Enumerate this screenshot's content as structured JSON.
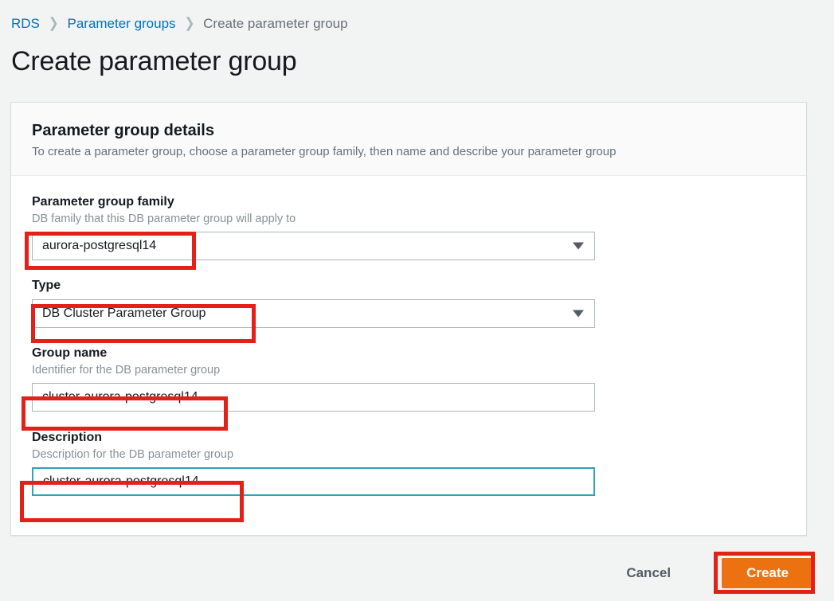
{
  "breadcrumb": {
    "items": [
      {
        "label": "RDS",
        "type": "link"
      },
      {
        "label": "Parameter groups",
        "type": "link"
      },
      {
        "label": "Create parameter group",
        "type": "current"
      }
    ],
    "separator": "❯"
  },
  "page": {
    "title": "Create parameter group"
  },
  "panel": {
    "title": "Parameter group details",
    "subtitle": "To create a parameter group, choose a parameter group family, then name and describe your parameter group"
  },
  "form": {
    "family": {
      "label": "Parameter group family",
      "hint": "DB family that this DB parameter group will apply to",
      "value": "aurora-postgresql14",
      "control": "select"
    },
    "type": {
      "label": "Type",
      "value": "DB Cluster Parameter Group",
      "control": "select"
    },
    "group_name": {
      "label": "Group name",
      "hint": "Identifier for the DB parameter group",
      "value": "cluster-aurora-postgresql14",
      "control": "text"
    },
    "description": {
      "label": "Description",
      "hint": "Description for the DB parameter group",
      "value": "cluster-aurora-postgresql14",
      "control": "text",
      "focused": true
    }
  },
  "actions": {
    "cancel_label": "Cancel",
    "create_label": "Create"
  },
  "colors": {
    "accent_orange": "#ec7211",
    "link_blue": "#0073bb",
    "annotation_red": "#e32119",
    "focus_teal": "#2ea3bb",
    "page_background": "#f2f3f3"
  }
}
